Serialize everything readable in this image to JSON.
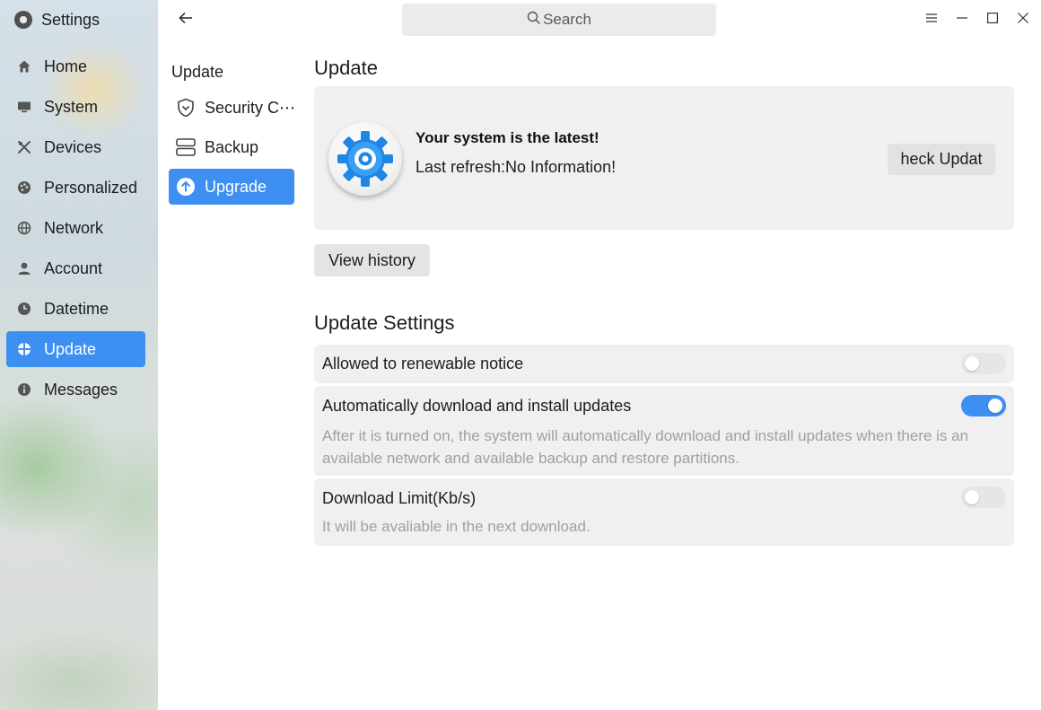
{
  "app": {
    "title": "Settings"
  },
  "search": {
    "placeholder": "Search"
  },
  "sidebar": {
    "items": [
      {
        "label": "Home",
        "icon": "home-icon"
      },
      {
        "label": "System",
        "icon": "monitor-icon"
      },
      {
        "label": "Devices",
        "icon": "devices-icon"
      },
      {
        "label": "Personalized",
        "icon": "palette-icon"
      },
      {
        "label": "Network",
        "icon": "globe-icon"
      },
      {
        "label": "Account",
        "icon": "user-icon"
      },
      {
        "label": "Datetime",
        "icon": "clock-icon"
      },
      {
        "label": "Update",
        "icon": "update-icon",
        "active": true
      },
      {
        "label": "Messages",
        "icon": "info-icon"
      }
    ]
  },
  "subnav": {
    "heading": "Update",
    "items": [
      {
        "label": "Security C⋯",
        "icon": "shield-icon"
      },
      {
        "label": "Backup",
        "icon": "backup-icon"
      },
      {
        "label": "Upgrade",
        "icon": "upgrade-arrow-icon",
        "active": true
      }
    ]
  },
  "main": {
    "title": "Update",
    "status": {
      "title": "Your system is the latest!",
      "subtitle": "Last refresh:No Information!",
      "check_button": "heck Updat"
    },
    "history_button": "View history",
    "settings_title": "Update Settings",
    "settings": [
      {
        "label": "Allowed to renewable notice",
        "enabled": false
      },
      {
        "label": "Automatically download and install updates",
        "enabled": true,
        "desc": "After it is turned on, the system will automatically download and install updates when there is an available network and available backup and restore partitions."
      },
      {
        "label": "Download Limit(Kb/s)",
        "enabled": false,
        "desc": "It will be avaliable in the next download."
      }
    ]
  },
  "colors": {
    "accent": "#3d8ff2",
    "card": "#f0f0f0",
    "muted_text": "#a0a0a0"
  }
}
